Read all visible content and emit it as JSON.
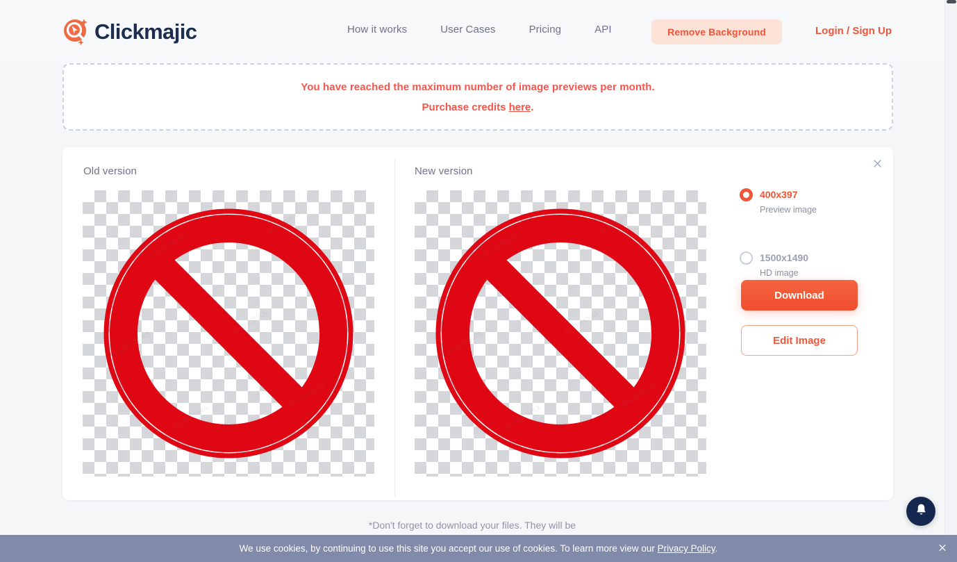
{
  "header": {
    "logo_text": "Clickmajic",
    "logo_icon": "cursor-magnifier-icon",
    "nav": [
      {
        "label": "How it works"
      },
      {
        "label": "User Cases"
      },
      {
        "label": "Pricing"
      },
      {
        "label": "API"
      }
    ],
    "remove_background_label": "Remove Background",
    "login_label": "Login / Sign Up"
  },
  "alert": {
    "line1": "You have reached the maximum number of image previews per month.",
    "line2_prefix": "Purchase credits ",
    "line2_link": "here",
    "line2_suffix": "."
  },
  "card": {
    "close_icon": "close-icon",
    "old_panel_title": "Old version",
    "new_panel_title": "New version",
    "image_subject": "red prohibition sign",
    "watermark_text": "shutterstock",
    "options": [
      {
        "size": "400x397",
        "description": "Preview image",
        "selected": true
      },
      {
        "size": "1500x1490",
        "description": "HD image",
        "selected": false
      }
    ],
    "download_label": "Download",
    "edit_label": "Edit Image"
  },
  "footer": {
    "note": "*Don't forget to download your files. They will be"
  },
  "notification": {
    "icon": "bell-icon"
  },
  "cookie": {
    "text_prefix": "We use cookies, by continuing to use this site you accept our use of cookies. To learn more view our ",
    "link": "Privacy Policy",
    "text_suffix": ".",
    "close_icon": "close-icon"
  },
  "colors": {
    "accent": "#f0553a",
    "accent_soft": "#fde2d8",
    "brand_navy": "#1d2d50",
    "sign_red": "#e00714",
    "cookie_bar": "#818aa8"
  }
}
